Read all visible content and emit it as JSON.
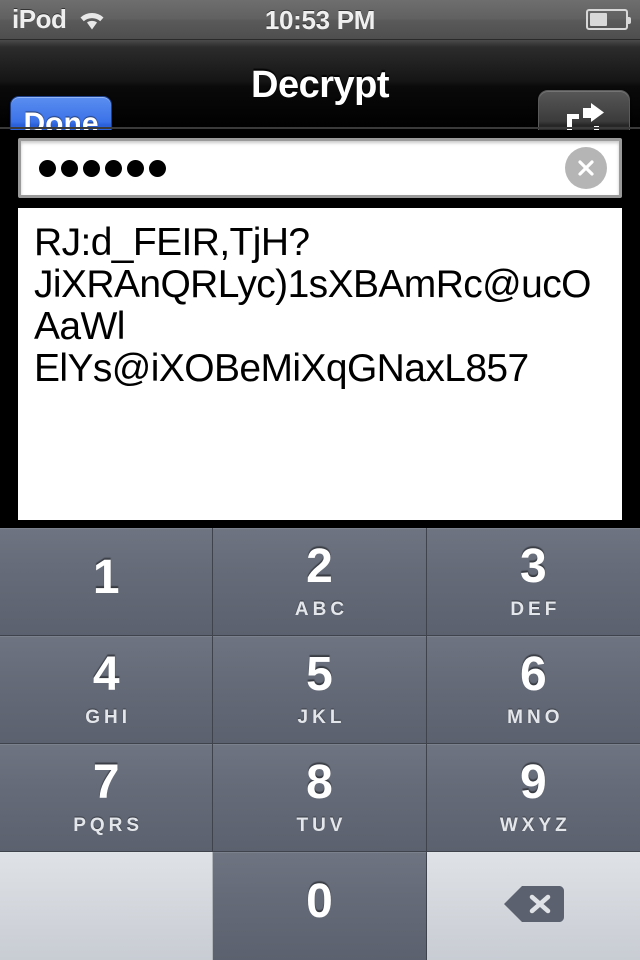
{
  "status_bar": {
    "carrier": "iPod",
    "wifi_icon": "wifi-icon",
    "time": "10:53 PM",
    "battery_icon": "battery-icon",
    "battery_level_percent": 50
  },
  "nav_bar": {
    "done_label": "Done",
    "title": "Decrypt",
    "share_icon": "share-icon"
  },
  "password_field": {
    "masked_value": "••••••",
    "dot_count": 6,
    "placeholder": "",
    "clear_icon": "clear-icon"
  },
  "cipher_field": {
    "value": "RJ:d_FEIR,TjH?JiXRAnQRLyc)1sXBAmRc@ucOAaWlElYs@iXOBeMiXqGNaxL857",
    "lines": [
      "RJ:d_FEIR,TjH?",
      "JiXRAnQRLyc)1sXBAmRc@ucOAaWl",
      "ElYs@iXOBeMiXqGNaxL857"
    ]
  },
  "keypad": {
    "keys": [
      {
        "digit": "1",
        "letters": ""
      },
      {
        "digit": "2",
        "letters": "ABC"
      },
      {
        "digit": "3",
        "letters": "DEF"
      },
      {
        "digit": "4",
        "letters": "GHI"
      },
      {
        "digit": "5",
        "letters": "JKL"
      },
      {
        "digit": "6",
        "letters": "MNO"
      },
      {
        "digit": "7",
        "letters": "PQRS"
      },
      {
        "digit": "8",
        "letters": "TUV"
      },
      {
        "digit": "9",
        "letters": "WXYZ"
      },
      {
        "digit": "0",
        "letters": ""
      }
    ],
    "delete_icon": "backspace-icon"
  },
  "colors": {
    "accent_blue": "#3b72e8",
    "navbar_black": "#000000",
    "keypad_key": "#656b78",
    "keypad_light": "#c8ccd3",
    "field_white": "#ffffff"
  }
}
